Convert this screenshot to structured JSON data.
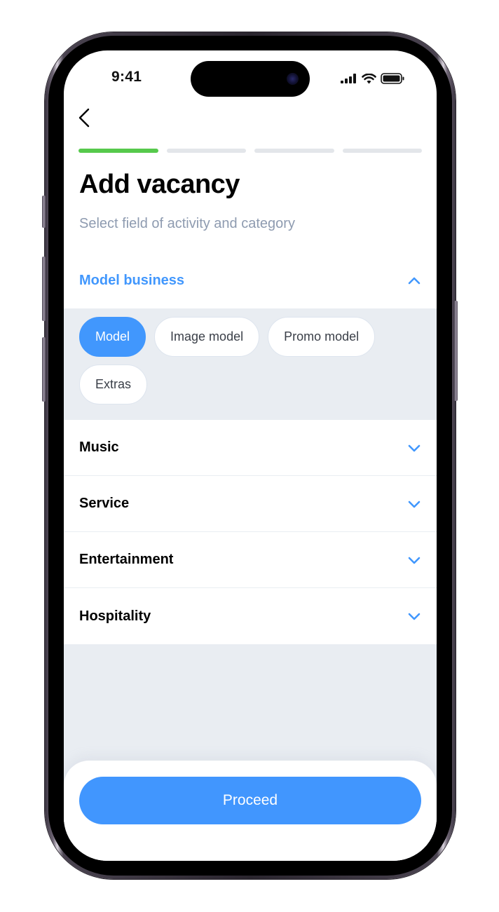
{
  "status_bar": {
    "time": "9:41",
    "icons": [
      "cellular-signal-icon",
      "wifi-icon",
      "battery-icon"
    ]
  },
  "nav": {
    "back_icon": "chevron-left-icon"
  },
  "progress": {
    "total_steps": 4,
    "completed_steps": 1,
    "colors": {
      "done": "#56c94c",
      "pending": "#e3e6ea"
    }
  },
  "header": {
    "title": "Add vacancy",
    "subtitle": "Select field of activity and category"
  },
  "accordion": {
    "open_section": {
      "label": "Model business",
      "icon": "chevron-up-icon",
      "chips": [
        {
          "label": "Model",
          "selected": true
        },
        {
          "label": "Image model",
          "selected": false
        },
        {
          "label": "Promo model",
          "selected": false
        },
        {
          "label": "Extras",
          "selected": false
        }
      ]
    },
    "closed_sections": [
      {
        "label": "Music",
        "icon": "chevron-down-icon"
      },
      {
        "label": "Service",
        "icon": "chevron-down-icon"
      },
      {
        "label": "Entertainment",
        "icon": "chevron-down-icon"
      },
      {
        "label": "Hospitality",
        "icon": "chevron-down-icon"
      }
    ]
  },
  "footer": {
    "proceed_label": "Proceed"
  },
  "colors": {
    "accent": "#4197fd",
    "subtitle": "#8e9bb0",
    "panel_bg": "#e9edf2"
  }
}
